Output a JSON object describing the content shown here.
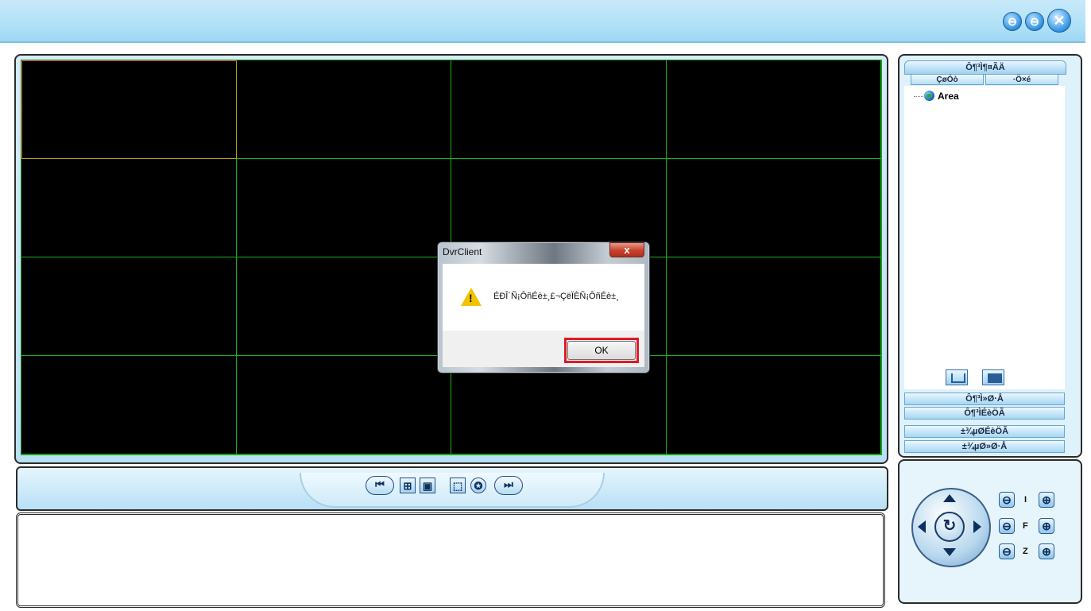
{
  "window": {
    "buttons": [
      {
        "name": "minimize",
        "glyph": "⊖"
      },
      {
        "name": "restore",
        "glyph": "⊖"
      },
      {
        "name": "close",
        "glyph": "✕"
      }
    ]
  },
  "video": {
    "rows": 4,
    "cols": 4,
    "selected_cell": 0
  },
  "controls": {
    "prev_glyph": "⏮",
    "next_glyph": "⏭",
    "buttons": [
      "grid-layout",
      "fullscreen",
      "select-window",
      "auto-cycle"
    ]
  },
  "right_panel": {
    "header": "Ô¶³Ì¶¤ÃÄ",
    "tabs": [
      "ÇøÓò",
      "·Ö×é"
    ],
    "tree_root": "Area",
    "menu_items": [
      "Ô¶³Ì»Ø·Å",
      "Ô¶³ÌÉèÖÃ",
      "±¾µØÉèÖÃ",
      "±¾µØ»Ø·Å"
    ]
  },
  "ptz": {
    "labels": [
      "I",
      "F",
      "Z"
    ],
    "minus_glyph": "⊖",
    "plus_glyph": "⊕",
    "center_glyph": "↻"
  },
  "dialog": {
    "title": "DvrClient",
    "close_glyph": "x",
    "message": "ÉÐÎ´Ñ¡ÔñÉè±¸£¬ÇëÏÈÑ¡ÔñÉè±¸",
    "ok_label": "OK",
    "highlight_color": "#e01a24"
  }
}
